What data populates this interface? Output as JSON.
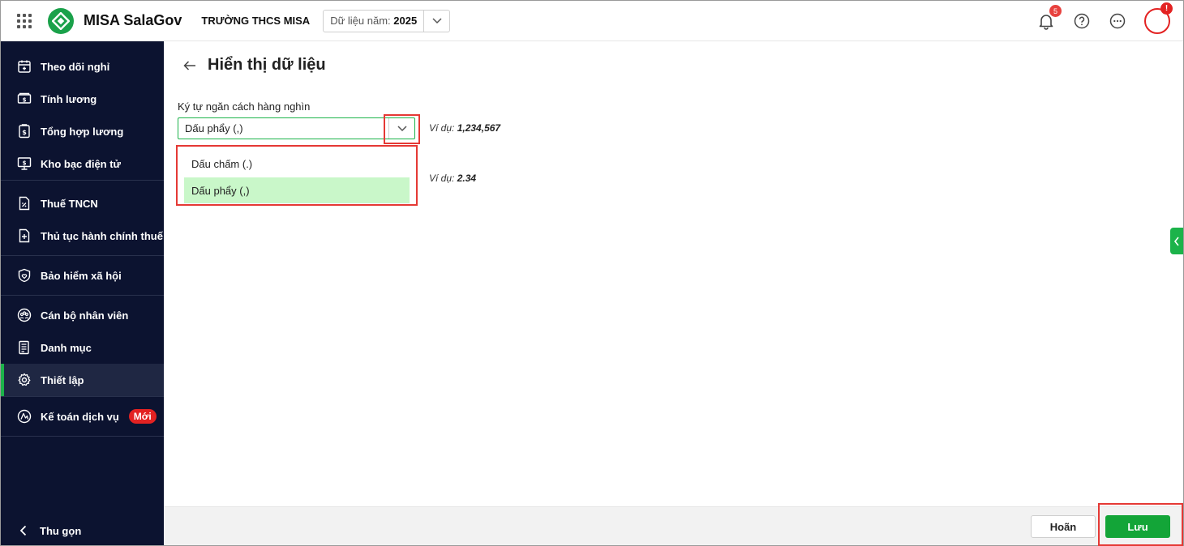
{
  "header": {
    "app_name": "MISA SalaGov",
    "school": "TRƯỜNG THCS MISA",
    "year_label": "Dữ liệu năm:",
    "year_value": "2025",
    "notification_count": "5",
    "avatar_alert": "!"
  },
  "sidebar": {
    "items": [
      {
        "label": "Theo dõi nghỉ",
        "icon": "calendar-icon"
      },
      {
        "label": "Tính lương",
        "icon": "money-icon"
      },
      {
        "label": "Tổng hợp lương",
        "icon": "salary-summary-icon"
      },
      {
        "label": "Kho bạc điện tử",
        "icon": "treasury-icon"
      },
      {
        "label": "Thuế TNCN",
        "icon": "tax-document-icon"
      },
      {
        "label": "Thủ tục hành chính thuế",
        "icon": "document-plus-icon"
      },
      {
        "label": "Bảo hiểm xã hội",
        "icon": "shield-heart-icon"
      },
      {
        "label": "Cán bộ nhân viên",
        "icon": "staff-icon"
      },
      {
        "label": "Danh mục",
        "icon": "list-document-icon"
      },
      {
        "label": "Thiết lập",
        "icon": "gear-icon"
      },
      {
        "label": "Kế toán dịch vụ",
        "icon": "accounting-service-icon",
        "badge": "Mới"
      }
    ],
    "active": "Thiết lập",
    "collapse_label": "Thu gọn"
  },
  "page": {
    "title": "Hiển thị dữ liệu",
    "thousand_sep_label": "Ký tự ngăn cách hàng nghìn",
    "thousand_sep_value": "Dấu phẩy (,)",
    "thousand_example_prefix": "Ví dụ:",
    "thousand_example_value": "1,234,567",
    "decimal_example_prefix": "Ví dụ:",
    "decimal_example_value": "2.34",
    "dropdown_options": [
      "Dấu chấm (.)",
      "Dấu phẩy (,)"
    ],
    "dropdown_selected": "Dấu phẩy (,)"
  },
  "footer": {
    "cancel_label": "Hoãn",
    "save_label": "Lưu"
  },
  "colors": {
    "brand_green": "#1cb34a",
    "sidebar_bg": "#0c1330",
    "highlight_red": "#e53935",
    "selected_option_bg": "#c9f7c9"
  }
}
